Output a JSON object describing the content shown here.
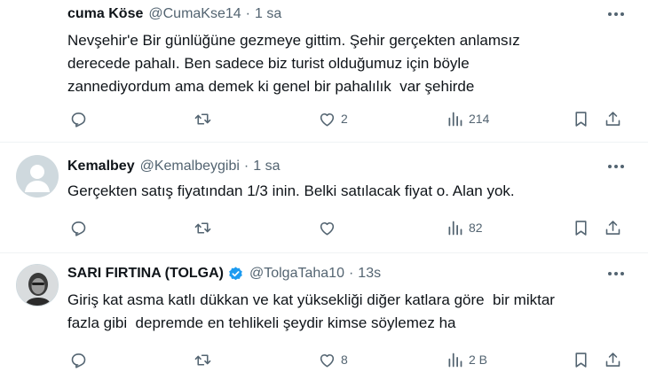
{
  "tweets": [
    {
      "name": "cuma Köse",
      "handle": "@CumaKse14",
      "time": "1 sa",
      "text": "Nevşehir'e Bir günlüğüne gezmeye gittim. Şehir gerçekten anlamsız\nderecede pahalı. Ben sadece biz turist olduğumuz için böyle\nzannediyordum ama demek ki genel bir pahalılık  var şehirde",
      "replies": "",
      "retweets": "",
      "likes": "2",
      "views": "214"
    },
    {
      "name": "Kemalbey",
      "handle": "@Kemalbeygibi",
      "time": "1 sa",
      "text": "Gerçekten satış fiyatından 1/3 inin. Belki satılacak fiyat o. Alan yok.",
      "replies": "",
      "retweets": "",
      "likes": "",
      "views": "82"
    },
    {
      "name": "SARI FIRTINA (TOLGA)",
      "handle": "@TolgaTaha10",
      "time": "13s",
      "text": "Giriş kat asma katlı dükkan ve kat yüksekliği diğer katlara göre  bir miktar\nfazla gibi  depremde en tehlikeli şeydir kimse söylemez ha",
      "replies": "",
      "retweets": "",
      "likes": "8",
      "views": "2 B"
    }
  ],
  "separator": "·",
  "colors": {
    "text": "#0f1419",
    "secondary": "#536471",
    "verified": "#1d9bf0",
    "divider": "#eff3f4"
  }
}
